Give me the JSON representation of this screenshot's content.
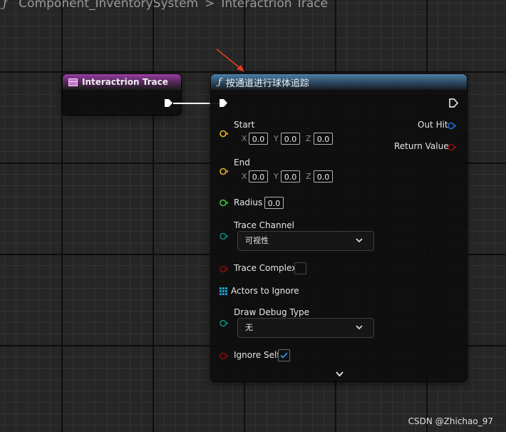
{
  "breadcrumb": {
    "icon": "function-icon",
    "items": [
      "Component_InventorySystem",
      "Interactrion Trace"
    ],
    "separator": ">"
  },
  "event_node": {
    "title": "Interactrion Trace",
    "header_color": "#9a3ea4"
  },
  "function_node": {
    "title": "按通道进行球体追踪",
    "header_color": "#4e7fa6",
    "inputs": {
      "start": {
        "label": "Start",
        "x_label": "X",
        "x": "0.0",
        "y_label": "Y",
        "y": "0.0",
        "z_label": "Z",
        "z": "0.0"
      },
      "end": {
        "label": "End",
        "x_label": "X",
        "x": "0.0",
        "y_label": "Y",
        "y": "0.0",
        "z_label": "Z",
        "z": "0.0"
      },
      "radius": {
        "label": "Radius",
        "value": "0.0"
      },
      "trace_channel": {
        "label": "Trace Channel",
        "value": "可视性"
      },
      "trace_complex": {
        "label": "Trace Complex",
        "checked": false
      },
      "actors_to_ignore": {
        "label": "Actors to Ignore"
      },
      "draw_debug_type": {
        "label": "Draw Debug Type",
        "value": "无"
      },
      "ignore_self": {
        "label": "Ignore Self",
        "checked": true
      }
    },
    "outputs": {
      "out_hit": {
        "label": "Out Hit"
      },
      "return_value": {
        "label": "Return Value"
      }
    }
  },
  "colors": {
    "vector_pin": "#e6b422",
    "float_pin": "#3fc63c",
    "enum_pin": "#0e8a78",
    "bool_pin": "#8c0e0e",
    "struct_pin": "#1b6fd6",
    "array_pin": "#1a9bd6",
    "annotation_arrow": "#e0401f"
  },
  "watermark": "CSDN @Zhichao_97"
}
